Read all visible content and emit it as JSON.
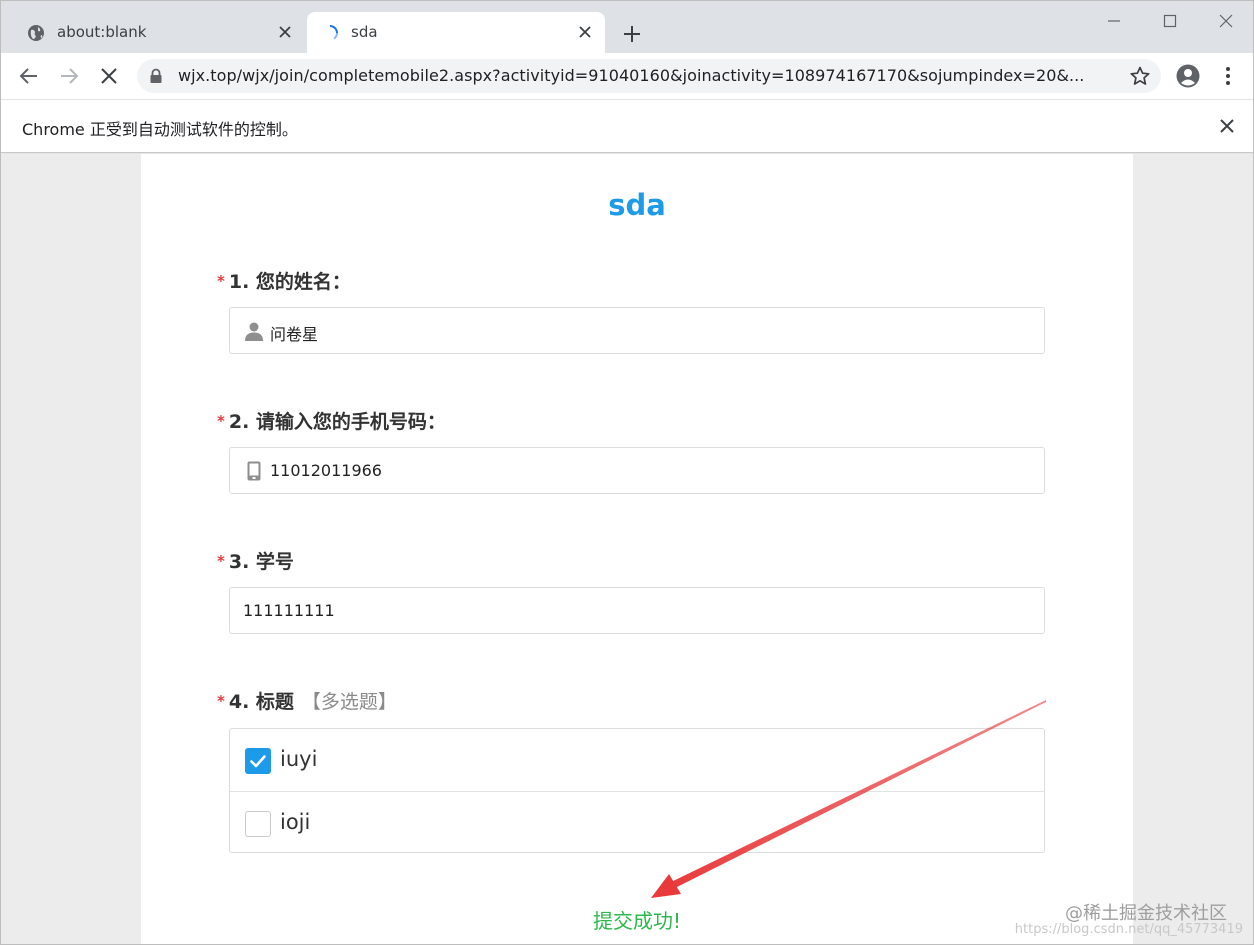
{
  "tabs": [
    {
      "title": "about:blank",
      "icon": "globe-icon"
    },
    {
      "title": "sda",
      "icon": "loading-spinner-icon"
    }
  ],
  "toolbar": {
    "url": "wjx.top/wjx/join/completemobile2.aspx?activityid=91040160&joinactivity=108974167170&sojumpindex=20&..."
  },
  "infobar": {
    "message": "Chrome 正受到自动测试软件的控制。"
  },
  "survey": {
    "title": "sda",
    "questions": [
      {
        "number": "1. 您的姓名：",
        "required": "*",
        "value": "问卷星",
        "icon": "user-icon"
      },
      {
        "number": "2. 请输入您的手机号码：",
        "required": "*",
        "value": "11012011966",
        "icon": "phone-icon"
      },
      {
        "number": "3. 学号",
        "required": "*",
        "value": "111111111"
      },
      {
        "number": "4. 标题",
        "required": "*",
        "hint": "【多选题】",
        "options": [
          {
            "label": "iuyi",
            "checked": true
          },
          {
            "label": "ioji",
            "checked": false
          }
        ]
      }
    ],
    "success_message": "提交成功!"
  },
  "watermark": {
    "main": "@稀土掘金技术社区",
    "url": "https://blog.csdn.net/qq_45773419"
  },
  "colors": {
    "accent": "#1e9be8",
    "required": "#e23b3b",
    "success": "#2db84d",
    "arrow": "#e8393b"
  }
}
